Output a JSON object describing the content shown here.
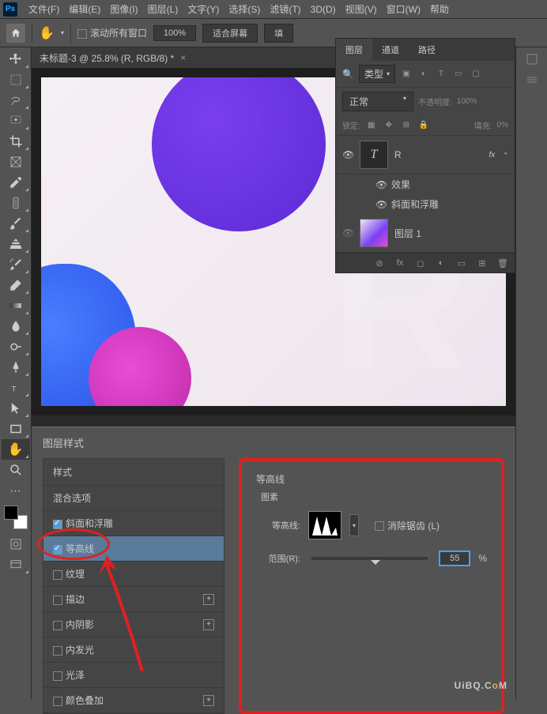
{
  "menu": {
    "file": "文件(F)",
    "edit": "编辑(E)",
    "image": "图像(I)",
    "layer": "图层(L)",
    "type": "文字(Y)",
    "select": "选择(S)",
    "filter": "滤镜(T)",
    "threed": "3D(D)",
    "view": "视图(V)",
    "window": "窗口(W)",
    "help": "帮助"
  },
  "options": {
    "scroll_all": "滚动所有窗口",
    "zoom": "100%",
    "fit": "适合屏幕",
    "fill": "填"
  },
  "doc": {
    "title": "未标题-3 @ 25.8% (R, RGB/8) *"
  },
  "panels": {
    "tabs": {
      "layers": "图层",
      "channels": "通道",
      "paths": "路径"
    },
    "filter_label": "类型",
    "blend_mode": "正常",
    "opacity_label": "不透明度:",
    "opacity_value": "100%",
    "lock_label": "锁定:",
    "fill_label": "填充:",
    "fill_value": "0%",
    "layer_r": "R",
    "layer_fx": "fx",
    "effects": "效果",
    "bevel": "斜面和浮雕",
    "layer1": "图层 1",
    "footer_fx": "fx"
  },
  "dialog": {
    "title": "图层样式",
    "styles_header": "样式",
    "blend_options": "混合选项",
    "list": {
      "bevel": "斜面和浮雕",
      "contour": "等高线",
      "texture": "纹理",
      "stroke": "描边",
      "inner_shadow": "内阴影",
      "inner_glow": "内发光",
      "satin": "光泽",
      "color_overlay": "颜色叠加"
    },
    "contour_title": "等高线",
    "contour_sub": "图素",
    "contour_label": "等高线:",
    "antialias": "消除锯齿 (L)",
    "range_label": "范围(R):",
    "range_value": "55",
    "range_unit": "%"
  },
  "watermark": {
    "pre": "UiBQ.C",
    "o": "o",
    "post": "M"
  }
}
